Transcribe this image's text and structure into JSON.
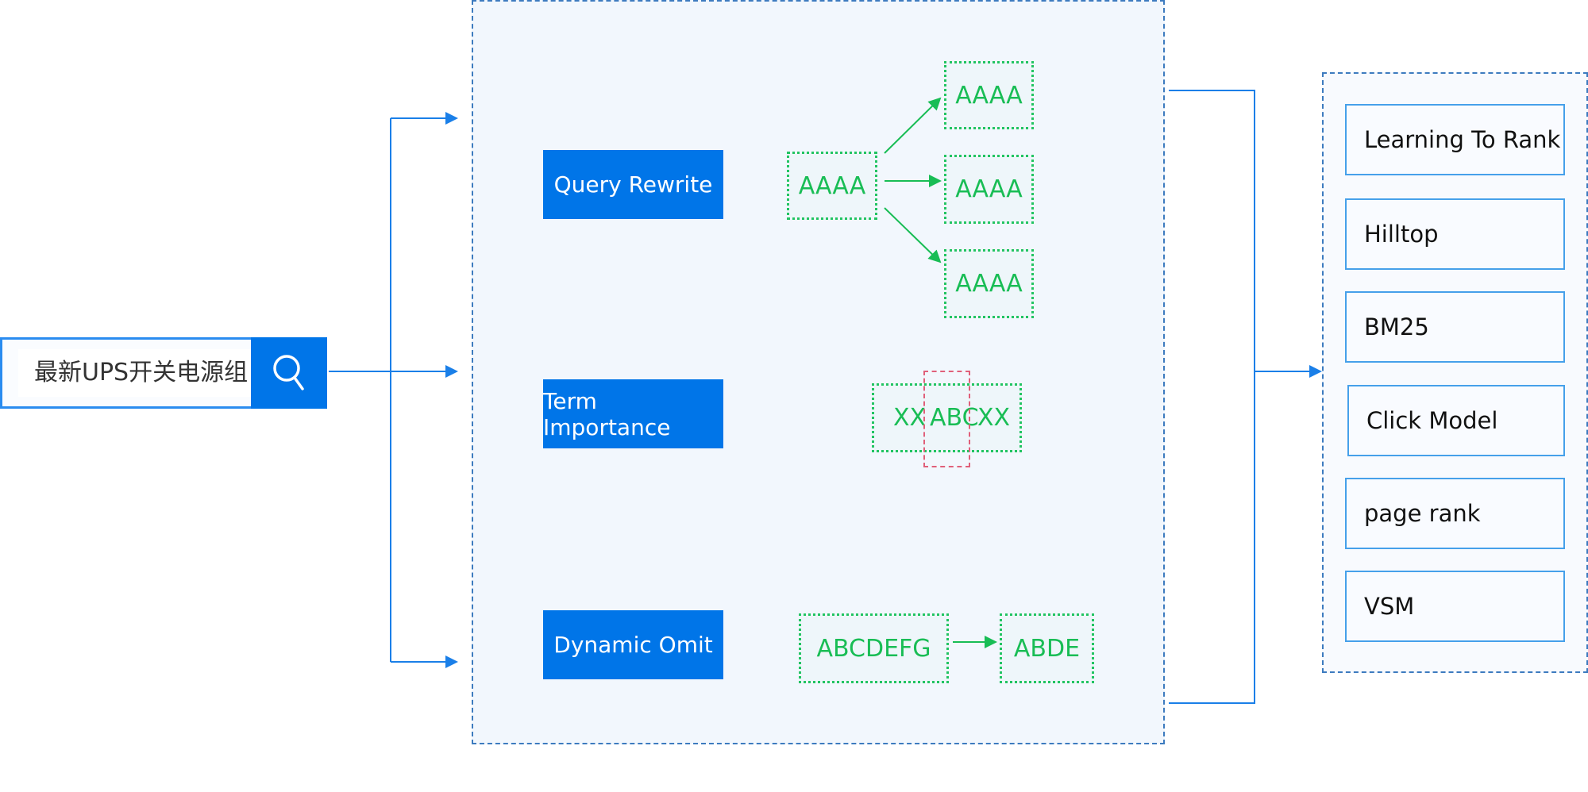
{
  "search": {
    "query": "最新UPS开关电源组",
    "icon": "search-icon"
  },
  "steps": [
    {
      "label": "Query Rewrite"
    },
    {
      "label": "Term Importance"
    },
    {
      "label": "Dynamic Omit"
    }
  ],
  "query_rewrite": {
    "source": "AAAA",
    "targets": [
      "AAAA",
      "AAAA",
      "AAAA"
    ]
  },
  "term_importance": {
    "left": "XX",
    "center": "ABC",
    "right": "XX"
  },
  "dynamic_omit": {
    "source": "ABCDEFG",
    "target": "ABDE"
  },
  "ranking": {
    "items": [
      "Learning To Rank",
      "Hilltop",
      "BM25",
      "Click Model",
      "page rank",
      "VSM"
    ]
  },
  "colors": {
    "accent": "#0075e8",
    "green": "#19bd55",
    "highlight": "#e0607a",
    "panel": "#f2f7fd"
  }
}
